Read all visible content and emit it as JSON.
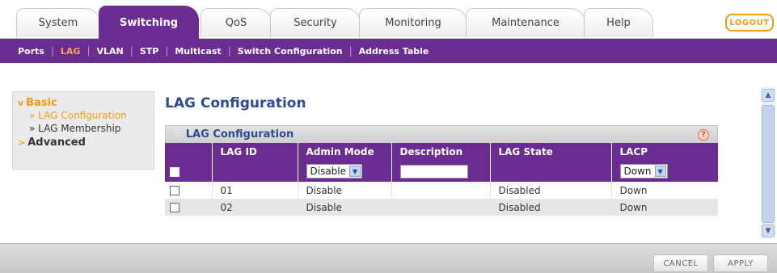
{
  "top_tabs": [
    {
      "label": "System"
    },
    {
      "label": "Switching"
    },
    {
      "label": "QoS"
    },
    {
      "label": "Security"
    },
    {
      "label": "Monitoring"
    },
    {
      "label": "Maintenance"
    },
    {
      "label": "Help"
    }
  ],
  "active_top_tab": "Switching",
  "logout_label": "LOGOUT",
  "sub_nav": [
    {
      "label": "Ports"
    },
    {
      "label": "LAG"
    },
    {
      "label": "VLAN"
    },
    {
      "label": "STP"
    },
    {
      "label": "Multicast"
    },
    {
      "label": "Switch Configuration"
    },
    {
      "label": "Address Table"
    }
  ],
  "active_sub_nav": "LAG",
  "left_nav": {
    "basic": {
      "label": "Basic",
      "mark": "v"
    },
    "basic_items": [
      {
        "label": "» LAG Configuration"
      },
      {
        "label": "» LAG Membership"
      }
    ],
    "advanced": {
      "label": "Advanced",
      "mark": ">"
    }
  },
  "page_title": "LAG Configuration",
  "panel": {
    "title": "LAG Configuration",
    "help_icon": "?"
  },
  "table": {
    "columns": [
      "",
      "LAG ID",
      "Admin Mode",
      "Description",
      "LAG State",
      "LACP"
    ],
    "edit_row": {
      "admin_mode": "Disable",
      "description": "",
      "lacp": "Down"
    },
    "rows": [
      {
        "lag_id": "01",
        "admin_mode": "Disable",
        "description": "",
        "lag_state": "Disabled",
        "lacp": "Down"
      },
      {
        "lag_id": "02",
        "admin_mode": "Disable",
        "description": "",
        "lag_state": "Disabled",
        "lacp": "Down"
      }
    ]
  },
  "footer": {
    "cancel_label": "CANCEL",
    "apply_label": "APPLY"
  },
  "colors": {
    "brand_purple": "#6b2c91",
    "accent_orange": "#f39c12",
    "title_blue": "#2d4b94"
  }
}
